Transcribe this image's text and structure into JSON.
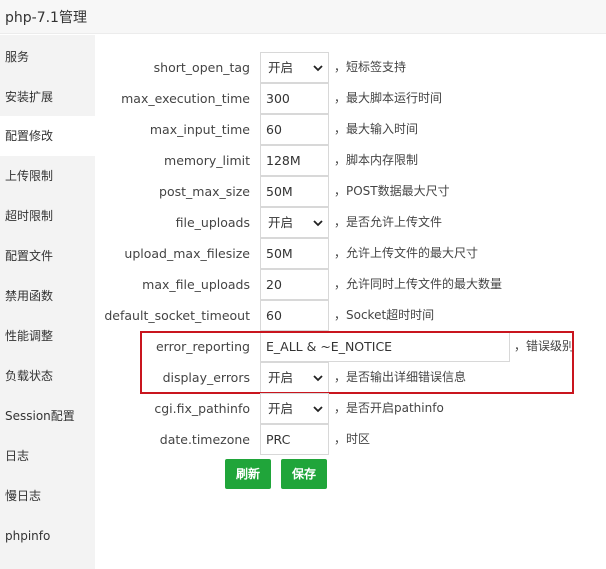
{
  "window": {
    "title": "php-7.1管理"
  },
  "sidebar": {
    "items": [
      {
        "label": "服务"
      },
      {
        "label": "安装扩展"
      },
      {
        "label": "配置修改"
      },
      {
        "label": "上传限制"
      },
      {
        "label": "超时限制"
      },
      {
        "label": "配置文件"
      },
      {
        "label": "禁用函数"
      },
      {
        "label": "性能调整"
      },
      {
        "label": "负载状态"
      },
      {
        "label": "Session配置"
      },
      {
        "label": "日志"
      },
      {
        "label": "慢日志"
      },
      {
        "label": "phpinfo"
      }
    ],
    "active_item": "配置修改"
  },
  "settings": [
    {
      "name": "short_open_tag",
      "type": "select",
      "value": "开启",
      "desc": "，短标签支持"
    },
    {
      "name": "max_execution_time",
      "type": "input",
      "value": "300",
      "desc": "，最大脚本运行时间"
    },
    {
      "name": "max_input_time",
      "type": "input",
      "value": "60",
      "desc": "，最大输入时间"
    },
    {
      "name": "memory_limit",
      "type": "input",
      "value": "128M",
      "desc": "，脚本内存限制"
    },
    {
      "name": "post_max_size",
      "type": "input",
      "value": "50M",
      "desc": "，POST数据最大尺寸"
    },
    {
      "name": "file_uploads",
      "type": "select",
      "value": "开启",
      "desc": "，是否允许上传文件"
    },
    {
      "name": "upload_max_filesize",
      "type": "input",
      "value": "50M",
      "desc": "，允许上传文件的最大尺寸"
    },
    {
      "name": "max_file_uploads",
      "type": "input",
      "value": "20",
      "desc": "，允许同时上传文件的最大数量"
    },
    {
      "name": "default_socket_timeout",
      "type": "input",
      "value": "60",
      "desc": "，Socket超时时间"
    },
    {
      "name": "error_reporting",
      "type": "input",
      "value": "E_ALL & ~E_NOTICE",
      "desc": "，错误级别"
    },
    {
      "name": "display_errors",
      "type": "select",
      "value": "开启",
      "desc": "，是否输出详细错误信息"
    },
    {
      "name": "cgi.fix_pathinfo",
      "type": "select",
      "value": "开启",
      "desc": "，是否开启pathinfo"
    },
    {
      "name": "date.timezone",
      "type": "input",
      "value": "PRC",
      "desc": "，时区"
    }
  ],
  "buttons": {
    "refresh": "刷新",
    "save": "保存"
  },
  "colors": {
    "accent": "#20a53a",
    "highlight_border": "#c9151e",
    "sidebar_bg": "#f3f3f3"
  },
  "icons": {
    "select_arrow": "chevron-down-icon"
  }
}
